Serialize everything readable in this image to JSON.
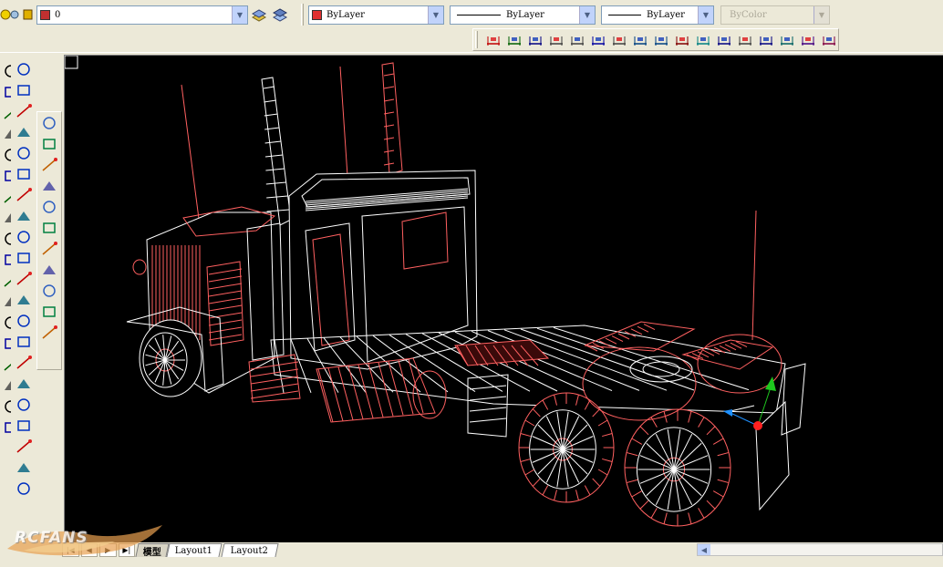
{
  "layers_toolbar": {
    "layer_value": "0",
    "layer_color": "#c03030"
  },
  "properties_toolbar": {
    "color": {
      "value": "ByLayer",
      "swatch": "#e03030"
    },
    "linetype": {
      "value": "ByLayer"
    },
    "lineweight": {
      "value": "ByLayer"
    },
    "plotstyle": {
      "value": "ByColor"
    }
  },
  "dimension_toolbar": {
    "tools": [
      "linear-dimension-icon",
      "aligned-dimension-icon",
      "ordinate-dimension-icon",
      "radius-dimension-icon",
      "diameter-dimension-icon",
      "angular-dimension-icon",
      "quick-dimension-icon",
      "baseline-dimension-icon",
      "continue-dimension-icon",
      "quick-leader-icon",
      "tolerance-icon",
      "center-mark-icon",
      "dimension-edit-icon",
      "dimension-text-edit-icon",
      "dimension-update-icon",
      "dimension-style-icon",
      "dim-style-control-icon"
    ]
  },
  "layout_tabs": {
    "tabs": [
      "模型",
      "Layout1",
      "Layout2"
    ],
    "active": 0
  },
  "watermark": {
    "text": "RCFANS"
  },
  "colors": {
    "canvas": "#000000",
    "wire_red": "#ff6060",
    "wire_white": "#ffffff",
    "axis_green": "#1ec81e",
    "axis_blue": "#1e90ff",
    "axis_red": "#ff2020"
  }
}
